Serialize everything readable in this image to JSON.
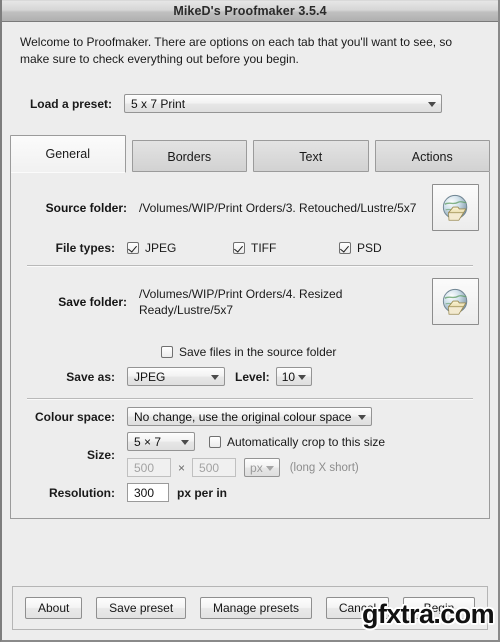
{
  "window": {
    "title": "MikeD's Proofmaker 3.5.4"
  },
  "intro": {
    "text": "Welcome to Proofmaker.  There are options on each tab that you'll want to see, so make sure to check everything out before you begin."
  },
  "preset": {
    "label": "Load a preset:",
    "value": "5 x 7  Print"
  },
  "tabs": [
    {
      "label": "General",
      "active": true
    },
    {
      "label": "Borders",
      "active": false
    },
    {
      "label": "Text",
      "active": false
    },
    {
      "label": "Actions",
      "active": false
    }
  ],
  "general": {
    "source_folder": {
      "label": "Source folder:",
      "path": "/Volumes/WIP/Print Orders/3. Retouched/Lustre/5x7",
      "browse_icon": "globe-folder-icon"
    },
    "file_types": {
      "label": "File types:",
      "options": [
        {
          "label": "JPEG",
          "checked": true
        },
        {
          "label": "TIFF",
          "checked": true
        },
        {
          "label": "PSD",
          "checked": true
        }
      ]
    },
    "save_folder": {
      "label": "Save folder:",
      "path": "/Volumes/WIP/Print Orders/4. Resized Ready/Lustre/5x7",
      "browse_icon": "globe-folder-icon"
    },
    "save_in_source": {
      "label": "Save files in the source folder",
      "checked": false
    },
    "save_as": {
      "label": "Save as:",
      "value": "JPEG",
      "level_label": "Level:",
      "level_value": "10"
    },
    "colour_space": {
      "label": "Colour space:",
      "value": "No change, use the original colour space"
    },
    "size": {
      "label": "Size:",
      "preset_value": "5 × 7",
      "auto_crop_label": "Automatically crop to this size",
      "auto_crop_checked": false,
      "width": "500",
      "height": "500",
      "times_symbol": "×",
      "unit_value": "px",
      "hint": "(long X short)"
    },
    "resolution": {
      "label": "Resolution:",
      "value": "300",
      "unit": "px per in"
    }
  },
  "footer": {
    "buttons": [
      {
        "label": "About"
      },
      {
        "label": "Save preset"
      },
      {
        "label": "Manage presets"
      },
      {
        "label": "Cancel"
      },
      {
        "label": "Begin"
      }
    ]
  },
  "watermark": {
    "text": "gfxtra.com"
  }
}
